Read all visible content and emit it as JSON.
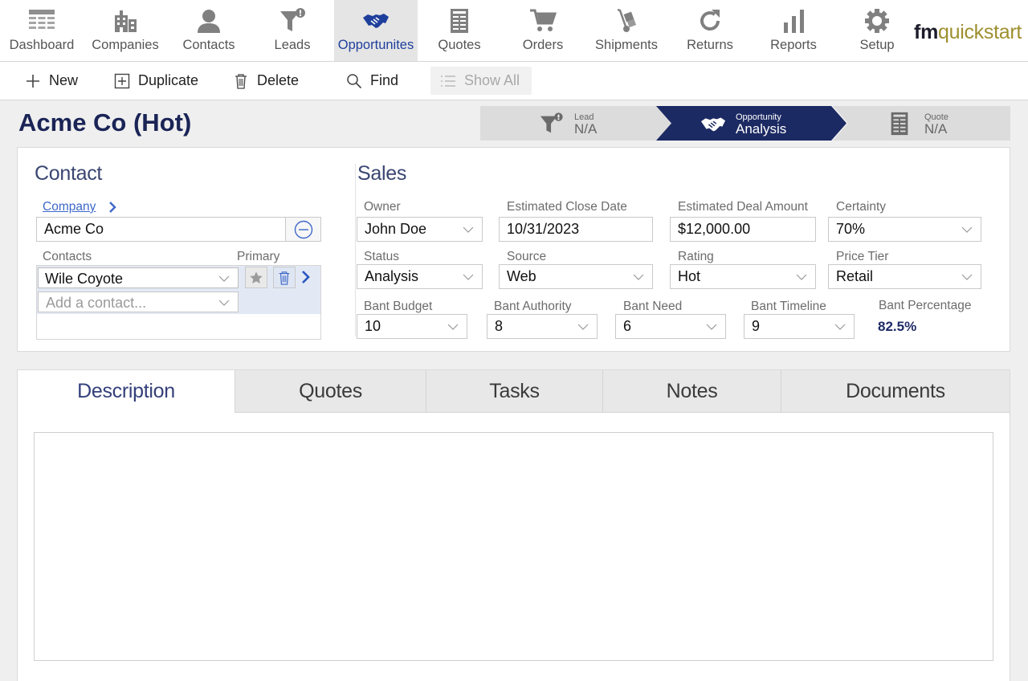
{
  "nav": {
    "items": [
      {
        "label": "Dashboard",
        "icon": "dashboard-icon"
      },
      {
        "label": "Companies",
        "icon": "companies-icon"
      },
      {
        "label": "Contacts",
        "icon": "contacts-icon"
      },
      {
        "label": "Leads",
        "icon": "leads-icon"
      },
      {
        "label": "Opportunites",
        "icon": "opportunities-icon",
        "active": true
      },
      {
        "label": "Quotes",
        "icon": "quotes-icon"
      },
      {
        "label": "Orders",
        "icon": "orders-icon"
      },
      {
        "label": "Shipments",
        "icon": "shipments-icon"
      },
      {
        "label": "Returns",
        "icon": "returns-icon"
      },
      {
        "label": "Reports",
        "icon": "reports-icon"
      },
      {
        "label": "Setup",
        "icon": "setup-icon"
      }
    ],
    "brand_bold": "fm",
    "brand_light": "quickstart"
  },
  "toolbar": {
    "new_label": "New",
    "duplicate_label": "Duplicate",
    "delete_label": "Delete",
    "find_label": "Find",
    "show_all_label": "Show All"
  },
  "header": {
    "title": "Acme Co (Hot)",
    "stages": [
      {
        "small": "Lead",
        "big": "N/A"
      },
      {
        "small": "Opportunity",
        "big": "Analysis"
      },
      {
        "small": "Quote",
        "big": "N/A"
      }
    ]
  },
  "contact": {
    "section_title": "Contact",
    "company_link": "Company",
    "company_value": "Acme Co",
    "contacts_label": "Contacts",
    "primary_label": "Primary",
    "contact_value": "Wile Coyote",
    "add_contact_placeholder": "Add a contact..."
  },
  "sales": {
    "section_title": "Sales",
    "owner_label": "Owner",
    "owner_value": "John Doe",
    "close_date_label": "Estimated Close Date",
    "close_date_value": "10/31/2023",
    "deal_amount_label": "Estimated Deal Amount",
    "deal_amount_value": "$12,000.00",
    "certainty_label": "Certainty",
    "certainty_value": "70%",
    "status_label": "Status",
    "status_value": "Analysis",
    "source_label": "Source",
    "source_value": "Web",
    "rating_label": "Rating",
    "rating_value": "Hot",
    "price_tier_label": "Price Tier",
    "price_tier_value": "Retail",
    "bant_budget_label": "Bant Budget",
    "bant_budget_value": "10",
    "bant_authority_label": "Bant Authority",
    "bant_authority_value": "8",
    "bant_need_label": "Bant Need",
    "bant_need_value": "6",
    "bant_timeline_label": "Bant Timeline",
    "bant_timeline_value": "9",
    "bant_percentage_label": "Bant Percentage",
    "bant_percentage_value": "82.5%"
  },
  "tabs": {
    "items": [
      "Description",
      "Quotes",
      "Tasks",
      "Notes",
      "Documents"
    ],
    "active": "Description"
  },
  "colors": {
    "primary_navy": "#1a2456",
    "active_stage": "#1c2a63",
    "link_blue": "#3d68c8",
    "brand_gold": "#9e8f2e"
  }
}
